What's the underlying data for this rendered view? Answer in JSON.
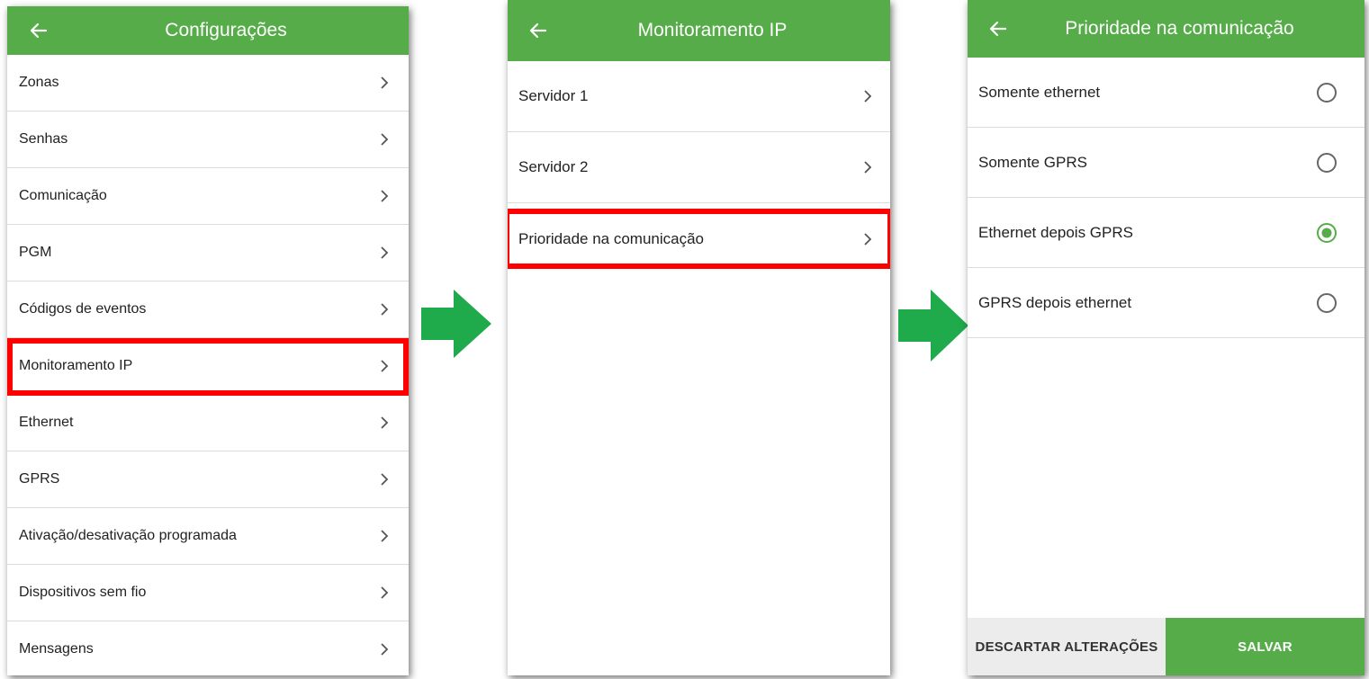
{
  "colors": {
    "appbar": "#55ac48",
    "highlight": "#ff0000",
    "flow_arrow": "#1faa4b",
    "radio_selected": "#55ac48",
    "save_button": "#55ac48",
    "discard_button": "#ececec"
  },
  "screen1": {
    "title": "Configurações",
    "back_icon": "arrow-left-icon",
    "items": [
      {
        "label": "Zonas"
      },
      {
        "label": "Senhas"
      },
      {
        "label": "Comunicação"
      },
      {
        "label": "PGM"
      },
      {
        "label": "Códigos de eventos"
      },
      {
        "label": "Monitoramento IP",
        "highlighted": true
      },
      {
        "label": "Ethernet"
      },
      {
        "label": "GPRS"
      },
      {
        "label": "Ativação/desativação programada"
      },
      {
        "label": "Dispositivos sem fio"
      },
      {
        "label": "Mensagens"
      }
    ]
  },
  "screen2": {
    "title": "Monitoramento IP",
    "back_icon": "arrow-left-icon",
    "items": [
      {
        "label": "Servidor 1"
      },
      {
        "label": "Servidor 2"
      },
      {
        "label": "Prioridade na comunicação",
        "highlighted": true
      }
    ]
  },
  "screen3": {
    "title": "Prioridade na comunicação",
    "back_icon": "arrow-left-icon",
    "options": [
      {
        "label": "Somente ethernet",
        "selected": false
      },
      {
        "label": "Somente GPRS",
        "selected": false
      },
      {
        "label": "Ethernet depois GPRS",
        "selected": true
      },
      {
        "label": "GPRS depois ethernet",
        "selected": false
      }
    ],
    "discard_label": "DESCARTAR ALTERAÇÕES",
    "save_label": "SALVAR"
  }
}
